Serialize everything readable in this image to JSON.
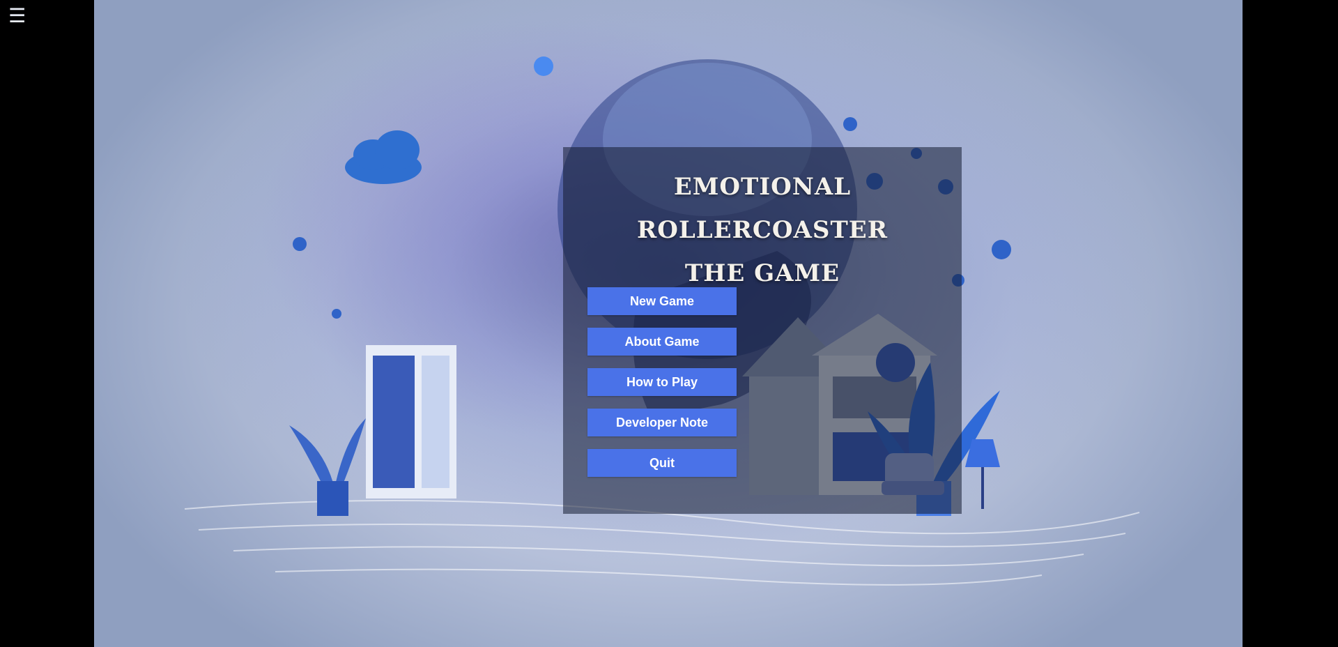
{
  "menu_toggle": {
    "glyph": "☰",
    "icon": "hamburger-menu-icon"
  },
  "title": {
    "line1": "EMOTIONAL ROLLERCOASTER",
    "line2": "THE GAME"
  },
  "main_menu": {
    "new_game": "New Game",
    "about_game": "About Game",
    "how_to_play": "How to Play",
    "developer_note": "Developer Note",
    "quit": "Quit"
  },
  "colors": {
    "button_bg": "#4a72e8",
    "button_text": "#ffffff",
    "title_text": "#f4f1ea",
    "page_bg": "#000000"
  }
}
